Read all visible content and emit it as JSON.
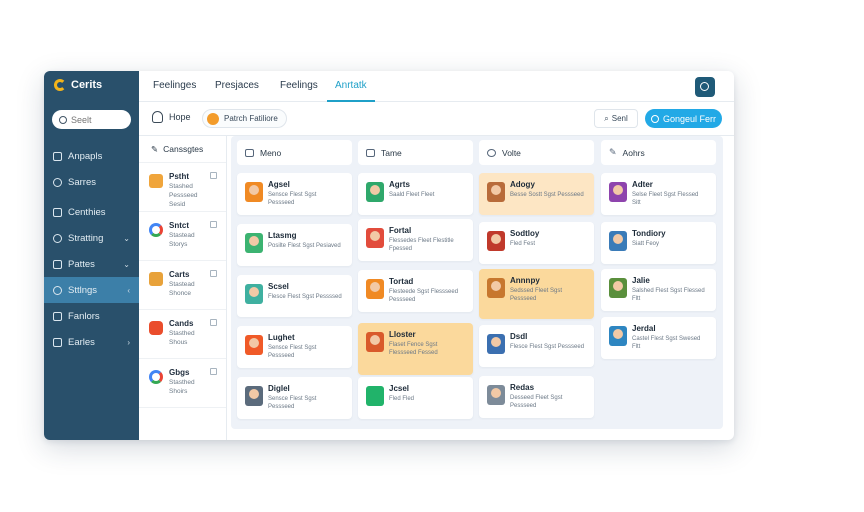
{
  "sidebar": {
    "brand": "Cerits",
    "search_placeholder": "Seelt",
    "items": [
      {
        "label": "Anpapls",
        "icon": "dashboard-icon",
        "chevron": ""
      },
      {
        "label": "Sarres",
        "icon": "settings-icon",
        "chevron": ""
      },
      {
        "label": "Centhies",
        "icon": "folder-icon",
        "chevron": ""
      },
      {
        "label": "Stratting",
        "icon": "gear-icon",
        "chevron": "⌄"
      },
      {
        "label": "Pattes",
        "icon": "shield-icon",
        "chevron": "⌄"
      },
      {
        "label": "Sttlngs",
        "icon": "settings-icon",
        "chevron": "‹"
      },
      {
        "label": "Fanlors",
        "icon": "list-icon",
        "chevron": ""
      },
      {
        "label": "Earles",
        "icon": "list-icon",
        "chevron": "›"
      }
    ]
  },
  "tabs": [
    "Feelinges",
    "Presjaces",
    "Feelings",
    "Anrtatk"
  ],
  "top_icons": [
    "search-icon",
    "plus-icon",
    "pin-icon",
    "settings-icon"
  ],
  "toolbar": {
    "user_label": "Hope",
    "filter_label": "Patrch Fatiliore",
    "send_label": "Senl",
    "primary_label": "Gongeul Ferr"
  },
  "contacts": {
    "header": "Canssgtes",
    "rows": [
      {
        "name": "Pstht",
        "sub": "Stashed Pessseed Sesid",
        "color": "#f0a53b"
      },
      {
        "name": "Sntct",
        "sub": "Stastead Storys",
        "color": "#4285f4"
      },
      {
        "name": "Carts",
        "sub": "Stastead Shonce",
        "color": "#e8a23a"
      },
      {
        "name": "Cands",
        "sub": "Stasthed Shous",
        "color": "#ea4d2c"
      },
      {
        "name": "Gbgs",
        "sub": "Stasthed Shoirs",
        "color": "#4285f4"
      }
    ]
  },
  "board": {
    "columns": [
      {
        "title": "Meno",
        "cards": [
          {
            "name": "Agsel",
            "desc": "Sensce Flest Sgst Pessseed",
            "color": "#f08a24",
            "hl": ""
          },
          {
            "name": "Ltasmg",
            "desc": "Posilte Flest Sgst Pesiaved",
            "color": "#3cb371",
            "hl": ""
          },
          {
            "name": "Scsel",
            "desc": "Flesce Flest Sgst Pessssed",
            "color": "#3fb0a0",
            "hl": ""
          },
          {
            "name": "Lughet",
            "desc": "Sensce Flest Sgst Pessseed",
            "color": "#f05a28",
            "hl": ""
          },
          {
            "name": "Diglel",
            "desc": "Sensce Flest Sgst Pessseed",
            "color": "#5b6b7c",
            "hl": ""
          }
        ]
      },
      {
        "title": "Tame",
        "cards": [
          {
            "name": "Agrts",
            "desc": "Saald Fleet Fleet",
            "color": "#2fa86b",
            "hl": ""
          },
          {
            "name": "Fortal",
            "desc": "Flessedes Fleet Flestitle Fpessed",
            "color": "#e24c3c",
            "hl": ""
          },
          {
            "name": "Tortad",
            "desc": "Flesteede Sgst Flessseed Pessseed",
            "color": "#f08a24",
            "hl": ""
          },
          {
            "name": "Lloster",
            "desc": "Flaset Fence Sgst Flessseed Fessed",
            "color": "#d95a2b",
            "hl": "strong"
          },
          {
            "name": "Jcsel",
            "desc": "Fled Fled",
            "color": "#21b36a",
            "hl": "",
            "plain": true
          }
        ]
      },
      {
        "title": "Volte",
        "cards": [
          {
            "name": "Adogy",
            "desc": "Besse Sostt Sgst Pessseed",
            "color": "#b86b3a",
            "hl": "soft"
          },
          {
            "name": "Sodtloy",
            "desc": "Fled Fest",
            "color": "#c0392b",
            "hl": ""
          },
          {
            "name": "Annnpy",
            "desc": "Sedssed Fleet Sgst Pessseed",
            "color": "#c7772e",
            "hl": "strong"
          },
          {
            "name": "Dsdl",
            "desc": "Flesce Flest Sgst Pessseed",
            "color": "#3b6fb0",
            "hl": ""
          },
          {
            "name": "Redas",
            "desc": "Desseed Fleet Sgst Pessseed",
            "color": "#7d8b99",
            "hl": ""
          }
        ]
      },
      {
        "title": "Aohrs",
        "cards": [
          {
            "name": "Adter",
            "desc": "Selse Fleet Sgst Flessed Sitt",
            "color": "#8e44ad",
            "hl": ""
          },
          {
            "name": "Tondiory",
            "desc": "Siatt Feoy",
            "color": "#3a7bb8",
            "hl": ""
          },
          {
            "name": "Jalie",
            "desc": "Salshed Flest Sgst Flessed Fltt",
            "color": "#5a8f3c",
            "hl": ""
          },
          {
            "name": "Jerdal",
            "desc": "Castel Flest Sgst Swesed Fltt",
            "color": "#2e86c1",
            "hl": ""
          }
        ]
      }
    ]
  }
}
